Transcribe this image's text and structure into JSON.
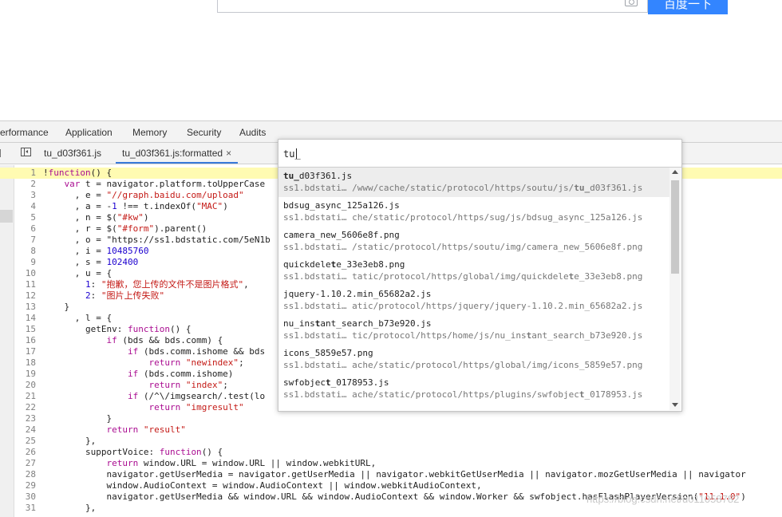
{
  "baidu": {
    "search_button": "百度一下"
  },
  "panel_tabs": [
    "erformance",
    "Application",
    "Memory",
    "Security",
    "Audits"
  ],
  "file_tabs": {
    "tab1": "tu_d03f361.js",
    "tab2": "tu_d03f361.js:formatted",
    "close": "×"
  },
  "quick_open": {
    "query": "tu_",
    "items": [
      {
        "title": "tu_d03f361.js",
        "path": "ss1.bdstati… /www/cache/static/protocol/https/soutu/js/tu_d03f361.js"
      },
      {
        "title": "bdsug_async_125a126.js",
        "path": "ss1.bdstati… che/static/protocol/https/sug/js/bdsug_async_125a126.js"
      },
      {
        "title": "camera_new_5606e8f.png",
        "path": "ss1.bdstati… /static/protocol/https/soutu/img/camera_new_5606e8f.png"
      },
      {
        "title": "quickdelete_33e3eb8.png",
        "path": "ss1.bdstati… tatic/protocol/https/global/img/quickdelete_33e3eb8.png"
      },
      {
        "title": "jquery-1.10.2.min_65682a2.js",
        "path": "ss1.bdstati… atic/protocol/https/jquery/jquery-1.10.2.min_65682a2.js"
      },
      {
        "title": "nu_instant_search_b73e920.js",
        "path": "ss1.bdstati… tic/protocol/https/home/js/nu_instant_search_b73e920.js"
      },
      {
        "title": "icons_5859e57.png",
        "path": "ss1.bdstati… ache/static/protocol/https/global/img/icons_5859e57.png"
      },
      {
        "title": "swfobject_0178953.js",
        "path": "ss1.bdstati… ache/static/protocol/https/plugins/swfobject_0178953.js"
      }
    ]
  },
  "code_lines": [
    {
      "n": "1",
      "text": "!function() {"
    },
    {
      "n": "2",
      "text": "    var t = navigator.platform.toUpperCase"
    },
    {
      "n": "3",
      "text": "      , e = \"//graph.baidu.com/upload\""
    },
    {
      "n": "4",
      "text": "      , a = -1 !== t.indexOf(\"MAC\")"
    },
    {
      "n": "5",
      "text": "      , n = $(\"#kw\")"
    },
    {
      "n": "6",
      "text": "      , r = $(\"#form\").parent()"
    },
    {
      "n": "7",
      "text": "      , o = \"https://ss1.bdstatic.com/5eN1b"
    },
    {
      "n": "8",
      "text": "      , i = 10485760"
    },
    {
      "n": "9",
      "text": "      , s = 102400"
    },
    {
      "n": "10",
      "text": "      , u = {"
    },
    {
      "n": "11",
      "text": "        1: \"抱歉，您上传的文件不是图片格式\","
    },
    {
      "n": "12",
      "text": "        2: \"图片上传失败\""
    },
    {
      "n": "13",
      "text": "    }"
    },
    {
      "n": "14",
      "text": "      , l = {"
    },
    {
      "n": "15",
      "text": "        getEnv: function() {"
    },
    {
      "n": "16",
      "text": "            if (bds && bds.comm) {"
    },
    {
      "n": "17",
      "text": "                if (bds.comm.ishome && bds"
    },
    {
      "n": "18",
      "text": "                    return \"newindex\";"
    },
    {
      "n": "19",
      "text": "                if (bds.comm.ishome)"
    },
    {
      "n": "20",
      "text": "                    return \"index\";"
    },
    {
      "n": "21",
      "text": "                if (/^\\/imgsearch/.test(lo"
    },
    {
      "n": "22",
      "text": "                    return \"imgresult\""
    },
    {
      "n": "23",
      "text": "            }"
    },
    {
      "n": "24",
      "text": "            return \"result\""
    },
    {
      "n": "25",
      "text": "        },"
    },
    {
      "n": "26",
      "text": "        supportVoice: function() {"
    },
    {
      "n": "27",
      "text": "            return window.URL = window.URL || window.webkitURL,"
    },
    {
      "n": "28",
      "text": "            navigator.getUserMedia = navigator.getUserMedia || navigator.webkitGetUserMedia || navigator.mozGetUserMedia || navigator"
    },
    {
      "n": "29",
      "text": "            window.AudioContext = window.AudioContext || window.webkitAudioContext,"
    },
    {
      "n": "30",
      "text": "            navigator.getUserMedia && window.URL && window.AudioContext && window.Worker && swfobject.hasFlashPlayerVersion(\"11.1.0\")"
    },
    {
      "n": "31",
      "text": "        },"
    }
  ],
  "watermark": "https://blog.csdn.net/u011058782"
}
